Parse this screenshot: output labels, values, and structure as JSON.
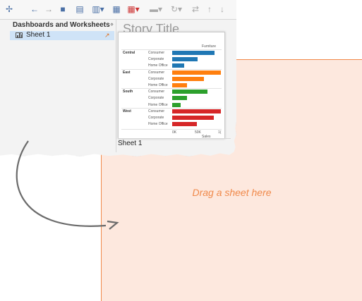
{
  "dropzone": {
    "text": "Drag a sheet here"
  },
  "toolbar": {
    "icons": [
      "new-data-source",
      "undo",
      "redo",
      "save",
      "new-worksheet",
      "new-dashboard",
      "show-me",
      "clear",
      "highlight",
      "refresh",
      "swap",
      "sort-asc",
      "sort-desc"
    ]
  },
  "panel": {
    "header": "Dashboards and Worksheets",
    "menu_glyph": "⋄",
    "sheets": [
      {
        "label": "Sheet 1"
      }
    ]
  },
  "story": {
    "title": "Story Title"
  },
  "tab": {
    "label": "Sheet 1"
  },
  "card": {
    "header": "Furniture",
    "regions": [
      {
        "name": "Central",
        "color": "#1f77b4",
        "segments": [
          {
            "label": "Consumer",
            "value": 0.87
          },
          {
            "label": "Corporate",
            "value": 0.52
          },
          {
            "label": "Home Office",
            "value": 0.25
          }
        ]
      },
      {
        "name": "East",
        "color": "#ff7f0e",
        "segments": [
          {
            "label": "Consumer",
            "value": 1.0
          },
          {
            "label": "Corporate",
            "value": 0.65
          },
          {
            "label": "Home Office",
            "value": 0.3
          }
        ]
      },
      {
        "name": "South",
        "color": "#2ca02c",
        "segments": [
          {
            "label": "Consumer",
            "value": 0.72
          },
          {
            "label": "Corporate",
            "value": 0.3
          },
          {
            "label": "Home Office",
            "value": 0.17
          }
        ]
      },
      {
        "name": "West",
        "color": "#d62728",
        "segments": [
          {
            "label": "Consumer",
            "value": 1.0
          },
          {
            "label": "Corporate",
            "value": 0.85
          },
          {
            "label": "Home Office",
            "value": 0.5
          }
        ]
      }
    ],
    "axis_ticks": [
      "0K",
      "50K",
      "1("
    ],
    "axis_label": "Sales"
  }
}
